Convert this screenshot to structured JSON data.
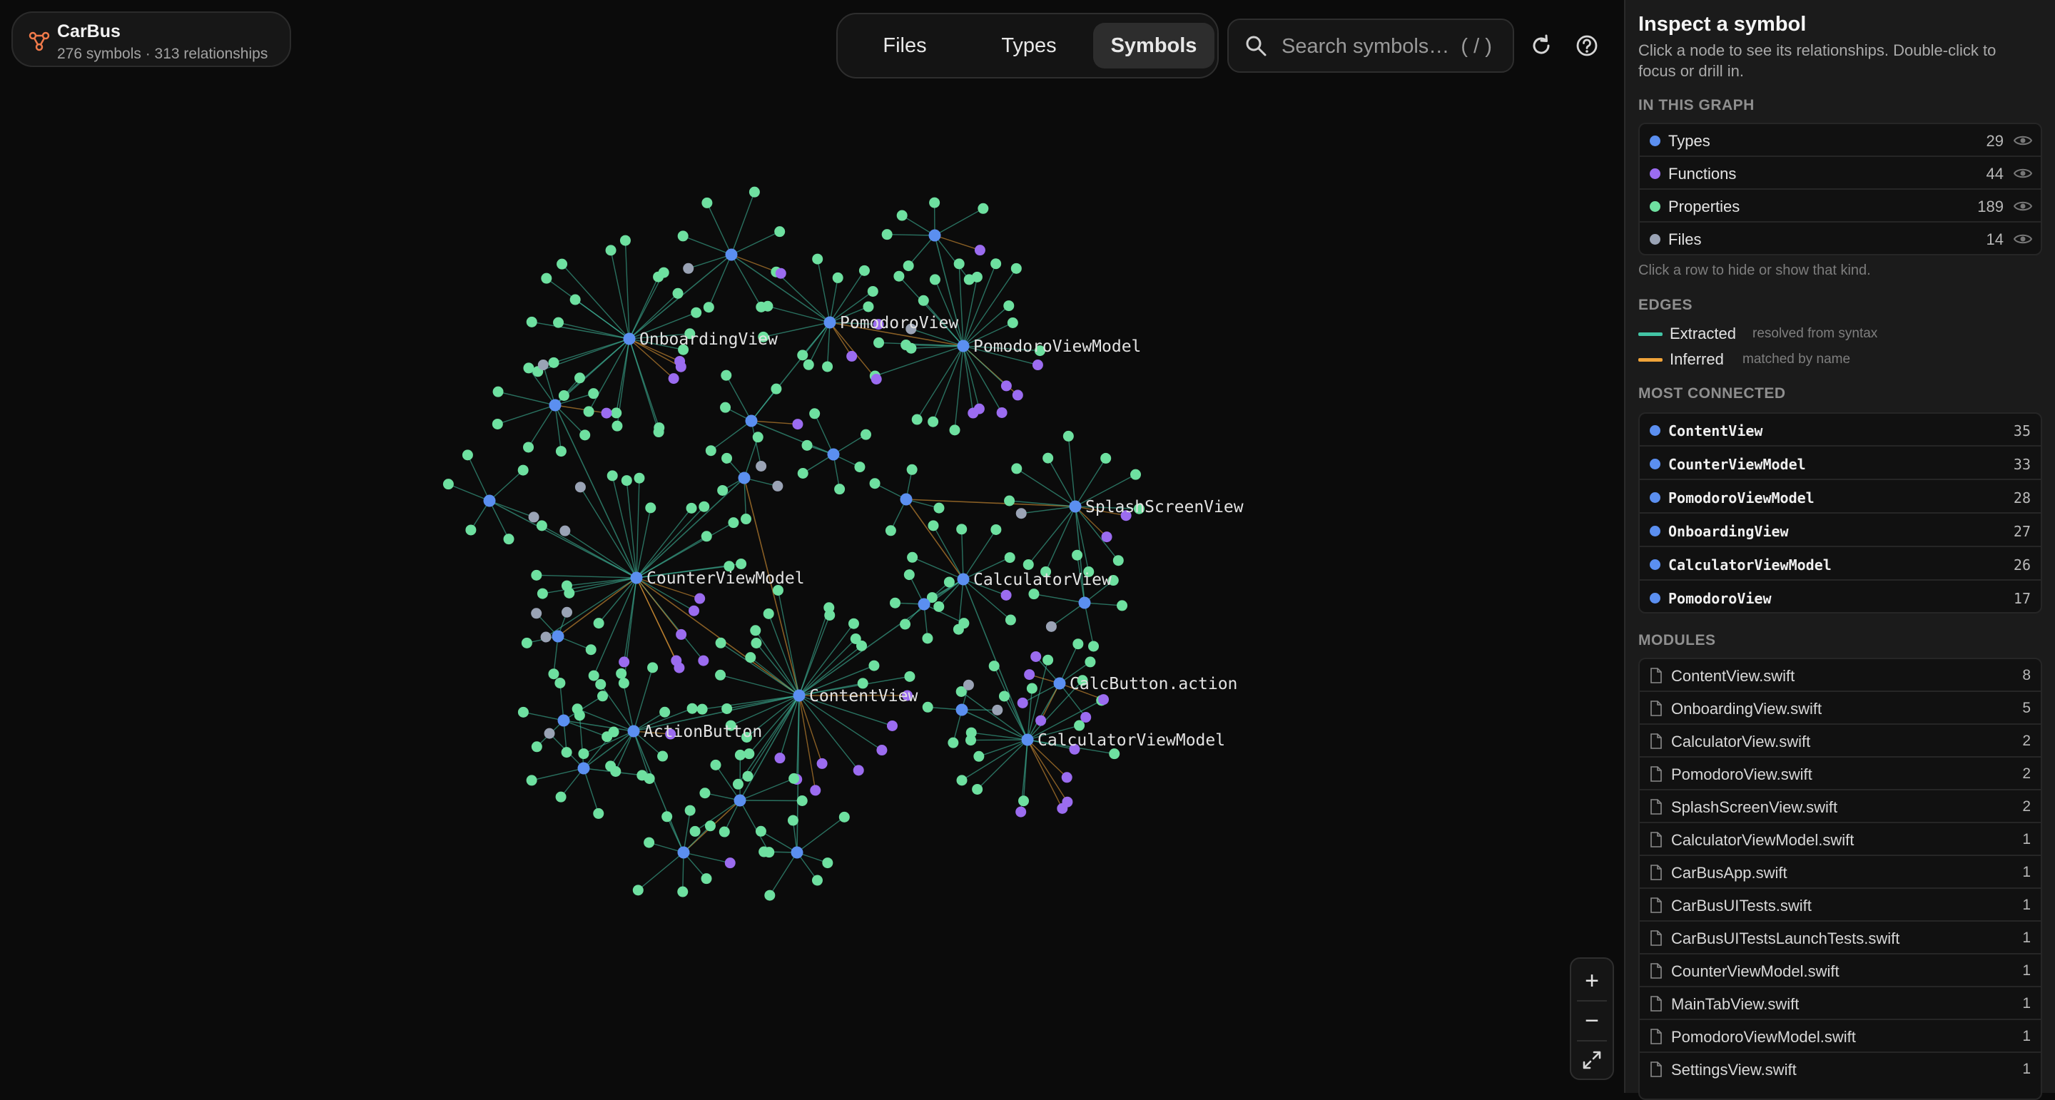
{
  "project": {
    "name": "CarBus",
    "stats": "276 symbols · 313 relationships"
  },
  "toolbar": {
    "tabs": [
      {
        "label": "Files"
      },
      {
        "label": "Types"
      },
      {
        "label": "Symbols",
        "active": true
      }
    ],
    "search_placeholder": "Search symbols…  ( / )",
    "reset_icon": "refresh-icon",
    "help_icon": "help-circle-icon"
  },
  "zoom": {
    "in": "+",
    "out": "−",
    "fit_icon": "expand-icon"
  },
  "colors": {
    "type": "#5b8ff0",
    "function": "#9b6cf0",
    "property": "#6ee0a0",
    "file": "#9aa3b5",
    "extracted": "#43c5a5",
    "inferred": "#f0a43a",
    "accent": "#f07a4a"
  },
  "graph": {
    "labels": {
      "onboarding": "OnboardingView",
      "pomodoro": "PomodoroView",
      "pomodoro_vm": "PomodoroViewModel",
      "splash": "SplashScreenView",
      "counter_vm": "CounterViewModel",
      "calculator": "CalculatorView",
      "calc_action": "CalcButton.action",
      "content": "ContentView",
      "action_button": "ActionButton",
      "calculator_vm": "CalculatorViewModel"
    }
  },
  "panel": {
    "title": "Inspect a symbol",
    "description": "Click a node to see its relationships. Double-click to focus or drill in.",
    "in_graph_heading": "IN THIS GRAPH",
    "kinds": [
      {
        "label": "Types",
        "count": "29",
        "color": "#5b8ff0"
      },
      {
        "label": "Functions",
        "count": "44",
        "color": "#9b6cf0"
      },
      {
        "label": "Properties",
        "count": "189",
        "color": "#6ee0a0"
      },
      {
        "label": "Files",
        "count": "14",
        "color": "#9aa3b5"
      }
    ],
    "kinds_hint": "Click a row to hide or show that kind.",
    "edges_heading": "EDGES",
    "edges": [
      {
        "label": "Extracted",
        "sub": "resolved from syntax",
        "color": "#43c5a5"
      },
      {
        "label": "Inferred",
        "sub": "matched by name",
        "color": "#f0a43a"
      }
    ],
    "most_connected_heading": "MOST CONNECTED",
    "most_connected": [
      {
        "label": "ContentView",
        "count": "35"
      },
      {
        "label": "CounterViewModel",
        "count": "33"
      },
      {
        "label": "PomodoroViewModel",
        "count": "28"
      },
      {
        "label": "OnboardingView",
        "count": "27"
      },
      {
        "label": "CalculatorViewModel",
        "count": "26"
      },
      {
        "label": "PomodoroView",
        "count": "17"
      }
    ],
    "modules_heading": "MODULES",
    "modules": [
      {
        "label": "ContentView.swift",
        "count": "8"
      },
      {
        "label": "OnboardingView.swift",
        "count": "5"
      },
      {
        "label": "CalculatorView.swift",
        "count": "2"
      },
      {
        "label": "PomodoroView.swift",
        "count": "2"
      },
      {
        "label": "SplashScreenView.swift",
        "count": "2"
      },
      {
        "label": "CalculatorViewModel.swift",
        "count": "1"
      },
      {
        "label": "CarBusApp.swift",
        "count": "1"
      },
      {
        "label": "CarBusUITests.swift",
        "count": "1"
      },
      {
        "label": "CarBusUITestsLaunchTests.swift",
        "count": "1"
      },
      {
        "label": "CounterViewModel.swift",
        "count": "1"
      },
      {
        "label": "MainTabView.swift",
        "count": "1"
      },
      {
        "label": "PomodoroViewModel.swift",
        "count": "1"
      },
      {
        "label": "SettingsView.swift",
        "count": "1"
      }
    ]
  }
}
